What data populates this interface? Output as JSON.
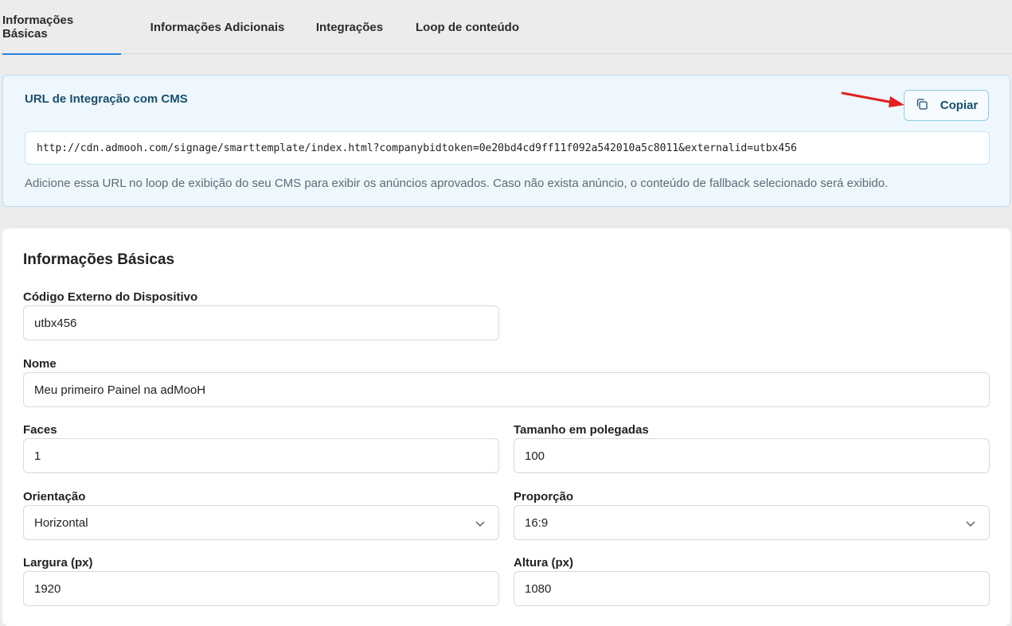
{
  "tabs": [
    {
      "label": "Informações Básicas",
      "active": true
    },
    {
      "label": "Informações Adicionais",
      "active": false
    },
    {
      "label": "Integrações",
      "active": false
    },
    {
      "label": "Loop de conteúdo",
      "active": false
    }
  ],
  "cms": {
    "title": "URL de Integração com CMS",
    "copy_label": "Copiar",
    "url": "http://cdn.admooh.com/signage/smarttemplate/index.html?companybidtoken=0e20bd4cd9ff11f092a542010a5c8011&externalid=utbx456",
    "help": "Adicione essa URL no loop de exibição do seu CMS para exibir os anúncios aprovados. Caso não exista anúncio, o conteúdo de fallback selecionado será exibido."
  },
  "form": {
    "title": "Informações Básicas",
    "external_code": {
      "label": "Código Externo do Dispositivo",
      "value": "utbx456"
    },
    "name": {
      "label": "Nome",
      "value": "Meu primeiro Painel na adMooH"
    },
    "faces": {
      "label": "Faces",
      "value": "1"
    },
    "size": {
      "label": "Tamanho em polegadas",
      "value": "100"
    },
    "orientation": {
      "label": "Orientação",
      "value": "Horizontal"
    },
    "ratio": {
      "label": "Proporção",
      "value": "16:9"
    },
    "width": {
      "label": "Largura (px)",
      "value": "1920"
    },
    "height": {
      "label": "Altura (px)",
      "value": "1080"
    }
  },
  "colors": {
    "accent": "#2a7de1",
    "annotation_arrow": "#e02020",
    "cms_bg": "#eef7fd"
  }
}
